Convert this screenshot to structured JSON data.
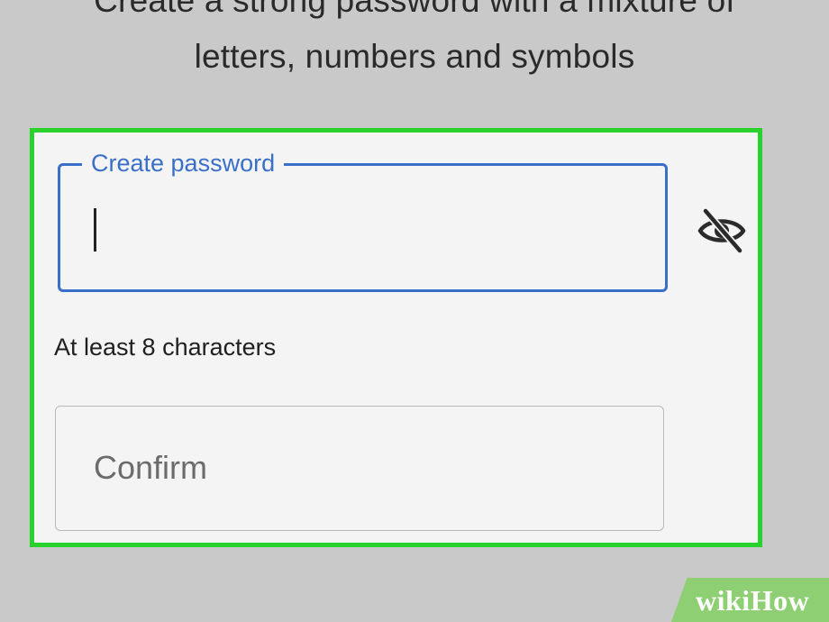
{
  "instruction": {
    "line1": "Create a strong password with a mixture of",
    "line2": "letters, numbers and symbols"
  },
  "password_field": {
    "label": "Create password",
    "value": "",
    "toggle_icon": "eye-slash-icon"
  },
  "helper_text": "At least 8 characters",
  "confirm_field": {
    "placeholder": "Confirm",
    "value": ""
  },
  "watermark": {
    "text": "wikiHow"
  },
  "colors": {
    "background": "#c9c9c9",
    "highlight": "#28d22a",
    "focus_blue": "#3a6fc9",
    "watermark_green": "#8fcf73"
  }
}
